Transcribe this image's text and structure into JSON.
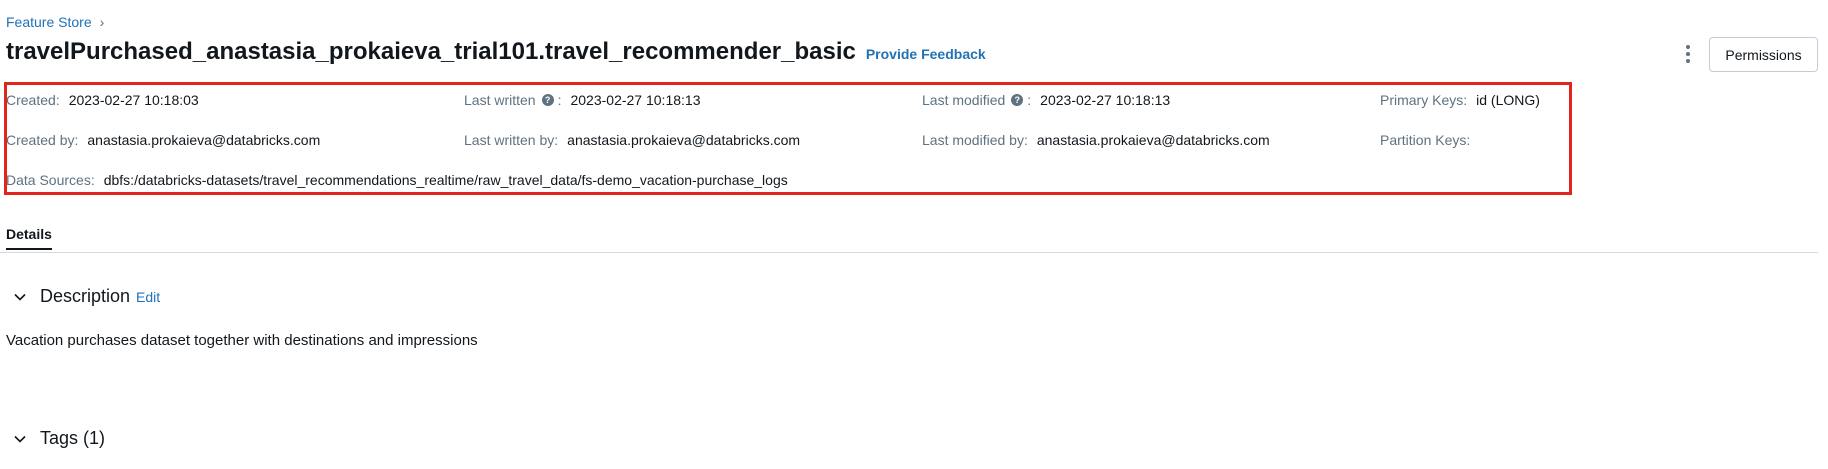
{
  "breadcrumb": {
    "root": "Feature Store",
    "separator": "›"
  },
  "header": {
    "title": "travelPurchased_anastasia_prokaieva_trial101.travel_recommender_basic",
    "feedback_link": "Provide Feedback",
    "permissions_button": "Permissions",
    "more_icon": "kebab-menu-icon"
  },
  "metadata": {
    "created": {
      "label": "Created",
      "value": "2023-02-27 10:18:03"
    },
    "last_written": {
      "label": "Last written",
      "value": "2023-02-27 10:18:13"
    },
    "last_modified": {
      "label": "Last modified",
      "value": "2023-02-27 10:18:13"
    },
    "primary_keys": {
      "label": "Primary Keys",
      "value": "id (LONG)"
    },
    "created_by": {
      "label": "Created by",
      "value": "anastasia.prokaieva@databricks.com"
    },
    "last_written_by": {
      "label": "Last written by",
      "value": "anastasia.prokaieva@databricks.com"
    },
    "last_modified_by": {
      "label": "Last modified by",
      "value": "anastasia.prokaieva@databricks.com"
    },
    "partition_keys": {
      "label": "Partition Keys",
      "value": ""
    },
    "data_sources": {
      "label": "Data Sources",
      "value": "dbfs:/databricks-datasets/travel_recommendations_realtime/raw_travel_data/fs-demo_vacation-purchase_logs"
    },
    "colon": ":"
  },
  "tabs": [
    {
      "label": "Details",
      "active": true
    }
  ],
  "description": {
    "title": "Description",
    "edit": "Edit",
    "text": "Vacation purchases dataset together with destinations and impressions"
  },
  "tags": {
    "title": "Tags (1)"
  },
  "colors": {
    "link": "#2272b4",
    "highlight_border": "#e0261c",
    "label": "#5f7281",
    "text": "#11171c"
  }
}
